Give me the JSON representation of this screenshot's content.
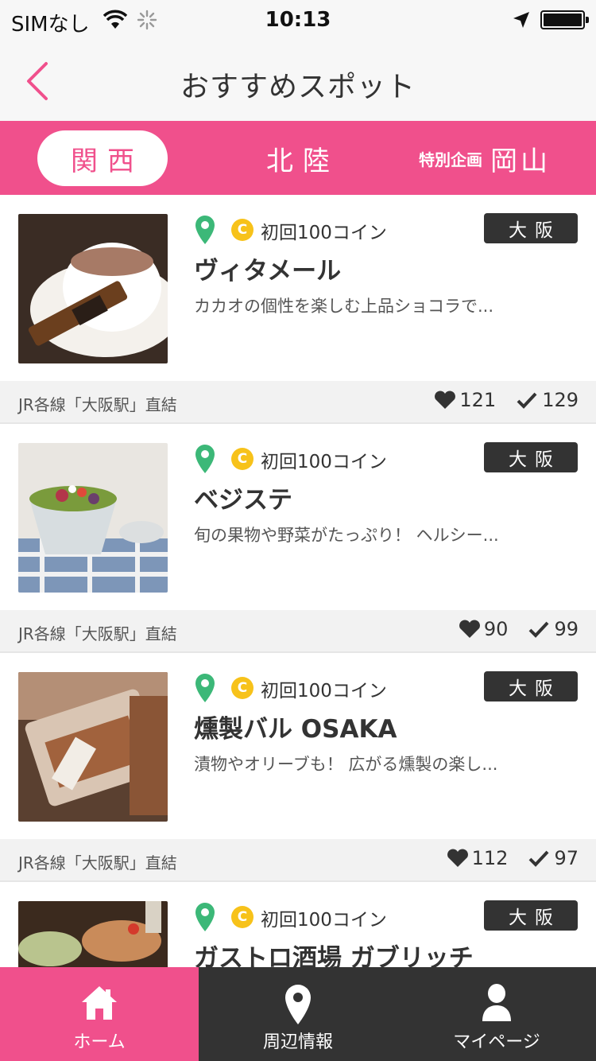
{
  "status_bar": {
    "carrier": "SIMなし",
    "time": "10:13"
  },
  "nav": {
    "title": "おすすめスポット",
    "back_icon": "chevron-left-icon"
  },
  "tabs": [
    {
      "label": "関西",
      "active": true
    },
    {
      "label": "北陸",
      "active": false
    },
    {
      "sub_label": "特別企画",
      "label": "岡山",
      "active": false
    }
  ],
  "colors": {
    "accent": "#f0508c",
    "dark": "#333333",
    "pin": "#3cb878",
    "coin": "#f7c21a"
  },
  "spots": [
    {
      "coin_text": "初回100コイン",
      "area": "大阪",
      "name": "ヴィタメール",
      "description": "カカオの個性を楽しむ上品ショコラで...",
      "access": "JR各線「大阪駅」直結",
      "likes": "121",
      "checkins": "129"
    },
    {
      "coin_text": "初回100コイン",
      "area": "大阪",
      "name": "ベジステ",
      "description": "旬の果物や野菜がたっぷり！ ヘルシー...",
      "access": "JR各線「大阪駅」直結",
      "likes": "90",
      "checkins": "99"
    },
    {
      "coin_text": "初回100コイン",
      "area": "大阪",
      "name": "燻製バル OSAKA",
      "description": "漬物やオリーブも！ 広がる燻製の楽し...",
      "access": "JR各線「大阪駅」直結",
      "likes": "112",
      "checkins": "97"
    },
    {
      "coin_text": "初回100コイン",
      "area": "大阪",
      "name": "ガストロ酒場 ガブリッチ"
    }
  ],
  "coin_glyph": "C",
  "tab_bar": [
    {
      "label": "ホーム",
      "icon": "home-icon",
      "active": true
    },
    {
      "label": "周辺情報",
      "icon": "map-pin-icon",
      "active": false
    },
    {
      "label": "マイページ",
      "icon": "person-icon",
      "active": false
    }
  ]
}
